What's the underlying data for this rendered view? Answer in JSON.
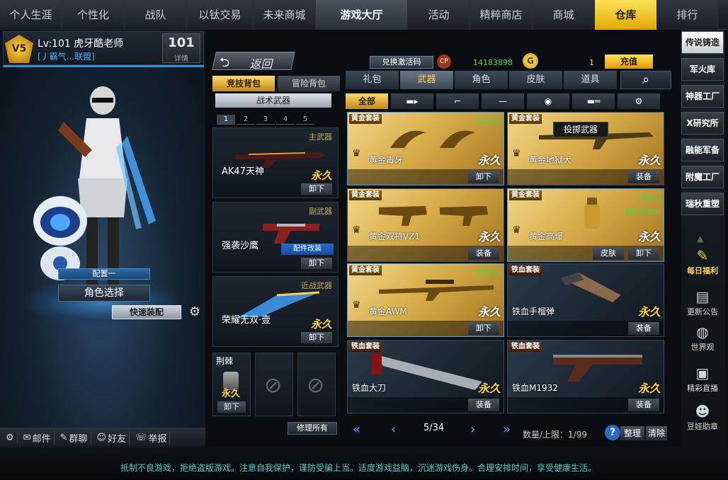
{
  "top_tabs": [
    "个人生涯",
    "个性化",
    "战队",
    "以钛交易",
    "未来商城",
    "游戏大厅",
    "活动",
    "精粹商店",
    "商城",
    "仓库",
    "排行"
  ],
  "profile": {
    "level_name": "Lv:101 虎牙酷老师",
    "guild": "[丿霸气...联盟]",
    "badge": "V5",
    "rank_num": "101",
    "detail_label": "详情"
  },
  "character": {
    "config_label": "配置一",
    "role_select": "角色选择",
    "quick_equip": "快速装配"
  },
  "bottom_bar": [
    "邮件",
    "群聊",
    "好友",
    "举报"
  ],
  "middle": {
    "back_label": "返回",
    "pack_tabs": [
      "竞技背包",
      "冒险背包"
    ],
    "tactic_button": "战术武器",
    "pages": [
      "1",
      "2",
      "3",
      "4",
      "5"
    ],
    "slots": [
      {
        "category": "主武器",
        "name": "AK47天神",
        "perm": "永久",
        "action": "卸下"
      },
      {
        "category": "副武器",
        "name": "强袭沙鹰",
        "perm": "",
        "action": "卸下",
        "tag": "配件改装"
      },
      {
        "category": "近战武器",
        "name": "荣耀无双·壹",
        "perm": "永久",
        "action": "卸下"
      }
    ],
    "thrown": {
      "name": "荆棘",
      "perm": "永久",
      "action": "卸下"
    },
    "repair_all": "修理所有"
  },
  "currency": {
    "redeem_label": "兑换激活码",
    "cp_label": "CP",
    "cp_value": "14183898",
    "g_label": "G",
    "g_value": "1",
    "charge_label": "充值"
  },
  "category_tabs": [
    "礼包",
    "武器",
    "角色",
    "皮肤",
    "道具"
  ],
  "sub_tabs": {
    "all": "全部"
  },
  "tooltip": "投掷武器",
  "cards": [
    {
      "set": "黄金套装",
      "name": "黄金毒牙",
      "perm": "永久",
      "buttons": [
        "卸下"
      ],
      "badge": "[背包4]",
      "style": "gold"
    },
    {
      "set": "黄金套装",
      "name": "黄金地狱犬",
      "perm": "永久",
      "buttons": [
        "装备"
      ],
      "badge": "",
      "style": "gold"
    },
    {
      "set": "黄金套装",
      "name": "黄金双持VZ1",
      "perm": "永久",
      "buttons": [
        "装备"
      ],
      "badge": "",
      "style": "gold"
    },
    {
      "set": "黄金套装",
      "name": "黄金高爆",
      "perm": "永久",
      "buttons": [
        "皮肤",
        "卸下"
      ],
      "badge": "[背包2]",
      "badge2": "[冒险背包2]",
      "style": "gold"
    },
    {
      "set": "黄金套装",
      "name": "黄金AWM",
      "perm": "永久",
      "buttons": [
        "卸下"
      ],
      "badge": "[背包5]",
      "style": "gold"
    },
    {
      "set": "铁血套装",
      "name": "铁血手榴弹",
      "perm": "永久",
      "buttons": [
        "装备"
      ],
      "badge": "",
      "style": "steel"
    },
    {
      "set": "铁血套装",
      "name": "铁血大刀",
      "perm": "永久",
      "buttons": [
        "装备"
      ],
      "badge": "",
      "style": "steel"
    },
    {
      "set": "铁血套装",
      "name": "铁血M1932",
      "perm": "永久",
      "buttons": [
        "装备"
      ],
      "badge": "",
      "style": "steel"
    }
  ],
  "pager": {
    "page": "5/34",
    "qty": "数量/上限：1/99",
    "help": "?",
    "sort": "整理",
    "clear": "清除"
  },
  "sidebar": [
    "传说铸造",
    "军火库",
    "神器工厂",
    "X研究所",
    "融能军备",
    "附魔工厂",
    "瑞秋重塑"
  ],
  "sidebar_icons": [
    "每日福利",
    "更新公告",
    "世界观",
    "精彩直播",
    "豆娃助章"
  ],
  "footer": "抵制不良游戏，拒绝盗版游戏。注意自我保护，谨防受骗上当。适度游戏益脑，沉迷游戏伤身。合理安排时间，享受健康生活。"
}
